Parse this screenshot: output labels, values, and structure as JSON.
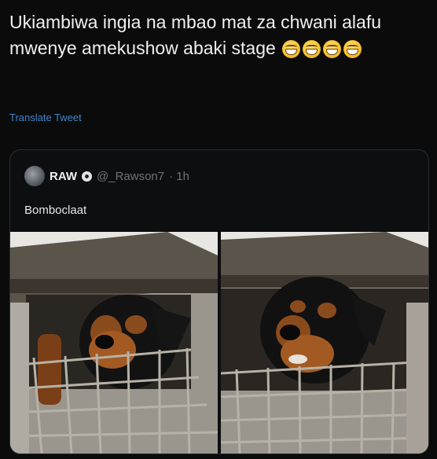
{
  "tweet": {
    "text": "Ukiambiwa ingia na mbao mat za chwani alafu mwenye amekushow abaki stage",
    "emojis": [
      "grinning-squinting-face",
      "grinning-squinting-face",
      "grinning-squinting-face",
      "grinning-squinting-face"
    ],
    "translate_label": "Translate Tweet"
  },
  "quote": {
    "name": "RAW",
    "handle": "@_Rawson7",
    "time": "· 1h",
    "text": "Bomboclaat",
    "images": [
      "rottweiler-in-crate-left",
      "rottweiler-in-crate-right"
    ]
  },
  "colors": {
    "background": "#0b0b0c",
    "link": "#3f86c9",
    "card_border": "#2a2d31"
  }
}
